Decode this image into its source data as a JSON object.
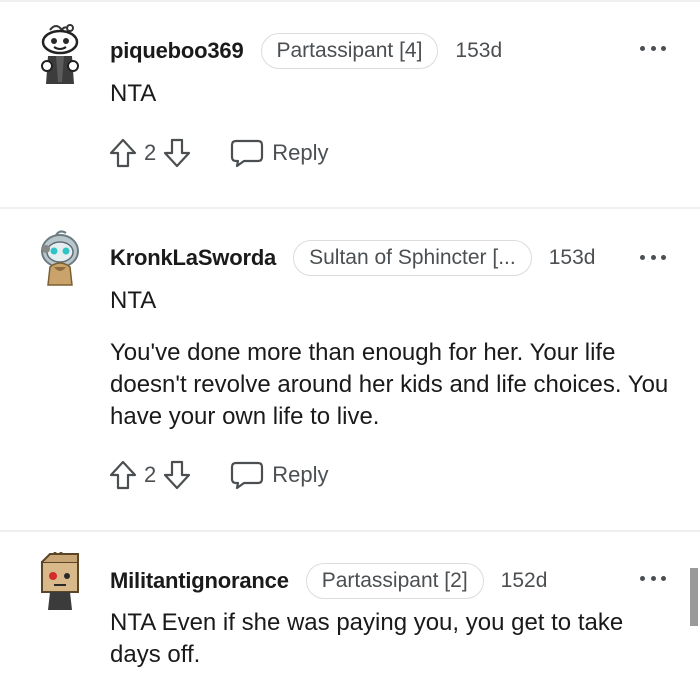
{
  "comments": [
    {
      "username": "piqueboo369",
      "flair": "Partassipant [4]",
      "age": "153d",
      "paragraphs": [
        "NTA"
      ],
      "score": "2",
      "reply_label": "Reply"
    },
    {
      "username": "KronkLaSworda",
      "flair": "Sultan of Sphincter [...",
      "age": "153d",
      "paragraphs": [
        "NTA",
        "You've done more than enough for her. Your life doesn't revolve around her kids and life choices. You have your own life to live."
      ],
      "score": "2",
      "reply_label": "Reply"
    },
    {
      "username": "Militantignorance",
      "flair": "Partassipant [2]",
      "age": "152d",
      "paragraphs": [
        "NTA Even if she was paying you, you get to take days off."
      ]
    }
  ],
  "icons": {
    "upvote": "arrow-up-outline-icon",
    "downvote": "arrow-down-outline-icon",
    "reply": "speech-bubble-icon",
    "more": "three-dots-icon"
  },
  "colors": {
    "text": "#1a1a1b",
    "meta": "#4b4f52",
    "divider": "#edeff1",
    "flair_border": "#dadcdf"
  }
}
